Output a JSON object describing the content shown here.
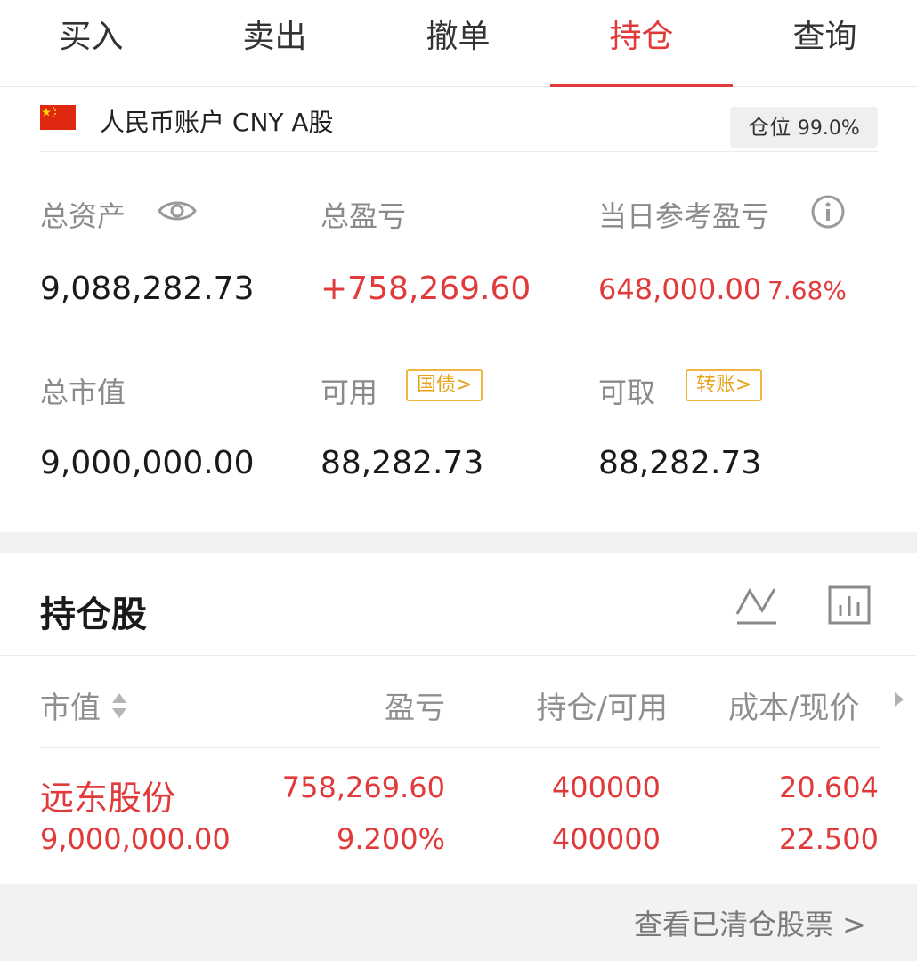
{
  "tabs": [
    {
      "label": "买入"
    },
    {
      "label": "卖出"
    },
    {
      "label": "撤单"
    },
    {
      "label": "持仓",
      "active": true
    },
    {
      "label": "查询"
    }
  ],
  "account": {
    "name": "人民币账户 CNY A股",
    "position_label": "仓位",
    "position_value": "99.0%"
  },
  "summary": {
    "total_assets_label": "总资产",
    "total_assets": "9,088,282.73",
    "total_pl_label": "总盈亏",
    "total_pl": "+758,269.60",
    "day_pl_label": "当日参考盈亏",
    "day_pl": "648,000.00",
    "day_pl_pct": "7.68%",
    "market_value_label": "总市值",
    "market_value": "9,000,000.00",
    "available_label": "可用",
    "available_chip": "国债>",
    "available": "88,282.73",
    "withdrawable_label": "可取",
    "withdrawable_chip": "转账>",
    "withdrawable": "88,282.73"
  },
  "holdings": {
    "title": "持仓股",
    "columns": {
      "market_value": "市值",
      "pl": "盈亏",
      "position": "持仓/可用",
      "cost_price": "成本/现价"
    },
    "rows": [
      {
        "name": "远东股份",
        "market_value": "9,000,000.00",
        "pl": "758,269.60",
        "pl_pct": "9.200%",
        "position": "400000",
        "available": "400000",
        "cost": "20.604",
        "price": "22.500"
      }
    ]
  },
  "footer": {
    "link": "查看已清仓股票 >"
  },
  "colors": {
    "accent_red": "#e03a3a",
    "chip_orange": "#f0b440",
    "label_gray": "#8a8a8a"
  }
}
